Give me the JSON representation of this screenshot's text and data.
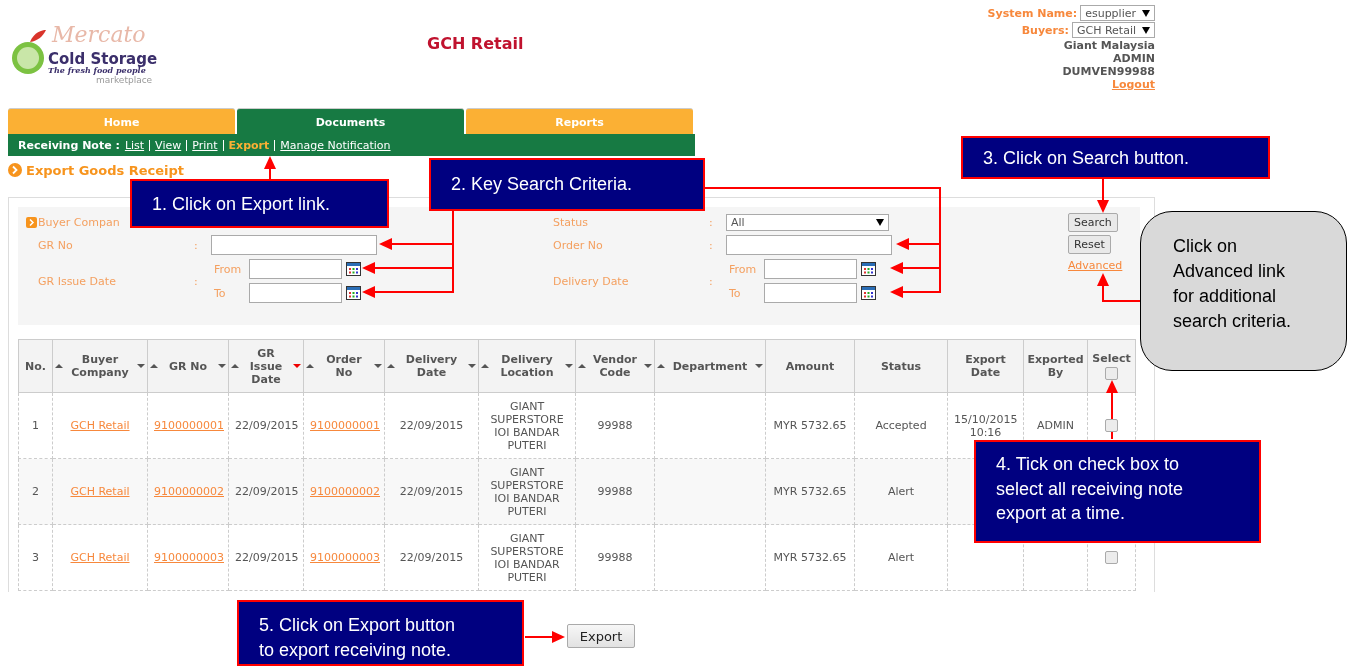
{
  "header": {
    "logo": {
      "script": "Mercato",
      "brand": "Cold Storage",
      "tagline": "The fresh food people",
      "sub": "marketplace"
    },
    "title": "GCH Retail",
    "user_panel": {
      "system_name": {
        "label": "System Name:",
        "value": "esupplier"
      },
      "buyers": {
        "label": "Buyers:",
        "value": "GCH Retail"
      },
      "lines": [
        "Giant Malaysia",
        "ADMIN",
        "DUMVEN99988"
      ],
      "logout": "Logout"
    }
  },
  "tabs": [
    {
      "label": "Home",
      "selected": false
    },
    {
      "label": "Documents",
      "selected": true
    },
    {
      "label": "Reports",
      "selected": false
    }
  ],
  "subnav": {
    "label": "Receiving Note :",
    "links": [
      {
        "label": "List",
        "selected": false
      },
      {
        "label": "View",
        "selected": false
      },
      {
        "label": "Print",
        "selected": false
      },
      {
        "label": "Export",
        "selected": true
      },
      {
        "label": "Manage Notification",
        "selected": false
      }
    ]
  },
  "page_title": "Export Goods Receipt",
  "search": {
    "left": [
      {
        "label": "Buyer Compan",
        "kind": "covered"
      },
      {
        "label": "GR No",
        "separator": ":",
        "kind": "text"
      },
      {
        "label": "GR Issue Date",
        "separator": ":",
        "kind": "date_range",
        "from": "From",
        "to": "To"
      }
    ],
    "right": [
      {
        "label": "Status",
        "separator": ":",
        "kind": "select",
        "value": "All"
      },
      {
        "label": "Order No",
        "separator": ":",
        "kind": "text"
      },
      {
        "label": "Delivery Date",
        "separator": ":",
        "kind": "date_range",
        "from": "From",
        "to": "To"
      }
    ],
    "buttons": [
      "Search",
      "Reset"
    ],
    "advanced_link": "Advanced"
  },
  "table": {
    "columns": [
      {
        "label": "No.",
        "kind": "text",
        "sortable": false
      },
      {
        "label": "Buyer Company",
        "kind": "link",
        "sortable": true,
        "sorted": false
      },
      {
        "label": "GR No",
        "kind": "link",
        "sortable": true,
        "sorted": false
      },
      {
        "label": "GR Issue Date",
        "kind": "text",
        "sortable": true,
        "sorted": true
      },
      {
        "label": "Order No",
        "kind": "link",
        "sortable": true,
        "sorted": false
      },
      {
        "label": "Delivery Date",
        "kind": "text",
        "sortable": true,
        "sorted": false
      },
      {
        "label": "Delivery Location",
        "kind": "text",
        "sortable": true,
        "sorted": false
      },
      {
        "label": "Vendor Code",
        "kind": "text",
        "sortable": true,
        "sorted": false
      },
      {
        "label": "Department",
        "kind": "text",
        "sortable": true,
        "sorted": false
      },
      {
        "label": "Amount",
        "kind": "text",
        "sortable": false
      },
      {
        "label": "Status",
        "kind": "text",
        "sortable": false
      },
      {
        "label": "Export Date",
        "kind": "text",
        "sortable": false
      },
      {
        "label": "Exported By",
        "kind": "text",
        "sortable": false
      },
      {
        "label": "Select",
        "kind": "check",
        "sortable": false,
        "checked": false
      }
    ],
    "rows": [
      {
        "no": "1",
        "buyer_company": "GCH Retail",
        "gr_no": "9100000001",
        "gr_issue_date": "22/09/2015",
        "order_no": "9100000001",
        "delivery_date": "22/09/2015",
        "delivery_location": "GIANT SUPERSTORE IOI BANDAR PUTERI",
        "vendor_code": "99988",
        "amount": "MYR 5732.65",
        "status": "Accepted",
        "export_date": "15/10/2015 10:16",
        "exported_by": "ADMIN",
        "checked": false
      },
      {
        "no": "2",
        "buyer_company": "GCH Retail",
        "gr_no": "9100000002",
        "gr_issue_date": "22/09/2015",
        "order_no": "9100000002",
        "delivery_date": "22/09/2015",
        "delivery_location": "GIANT SUPERSTORE IOI BANDAR PUTERI",
        "vendor_code": "99988",
        "amount": "MYR 5732.65",
        "status": "Alert"
      },
      {
        "no": "3",
        "buyer_company": "GCH Retail",
        "gr_no": "9100000003",
        "gr_issue_date": "22/09/2015",
        "order_no": "9100000003",
        "delivery_date": "22/09/2015",
        "delivery_location": "GIANT SUPERSTORE IOI BANDAR PUTERI",
        "vendor_code": "99988",
        "amount": "MYR 5732.65",
        "status": "Alert",
        "checked": false
      }
    ]
  },
  "export_button": "Export",
  "callouts": [
    {
      "kind": "box",
      "text": "1. Click on Export link."
    },
    {
      "kind": "box",
      "text": "2. Key Search Criteria."
    },
    {
      "kind": "box",
      "text": "3. Click on Search button."
    },
    {
      "kind": "bubble",
      "text": "Click on Advanced link for additional search criteria."
    },
    {
      "kind": "box",
      "text": "4. Tick on check box to select all receiving note export at a time."
    },
    {
      "kind": "box",
      "text": "5. Click on Export button to export receiving note."
    }
  ]
}
